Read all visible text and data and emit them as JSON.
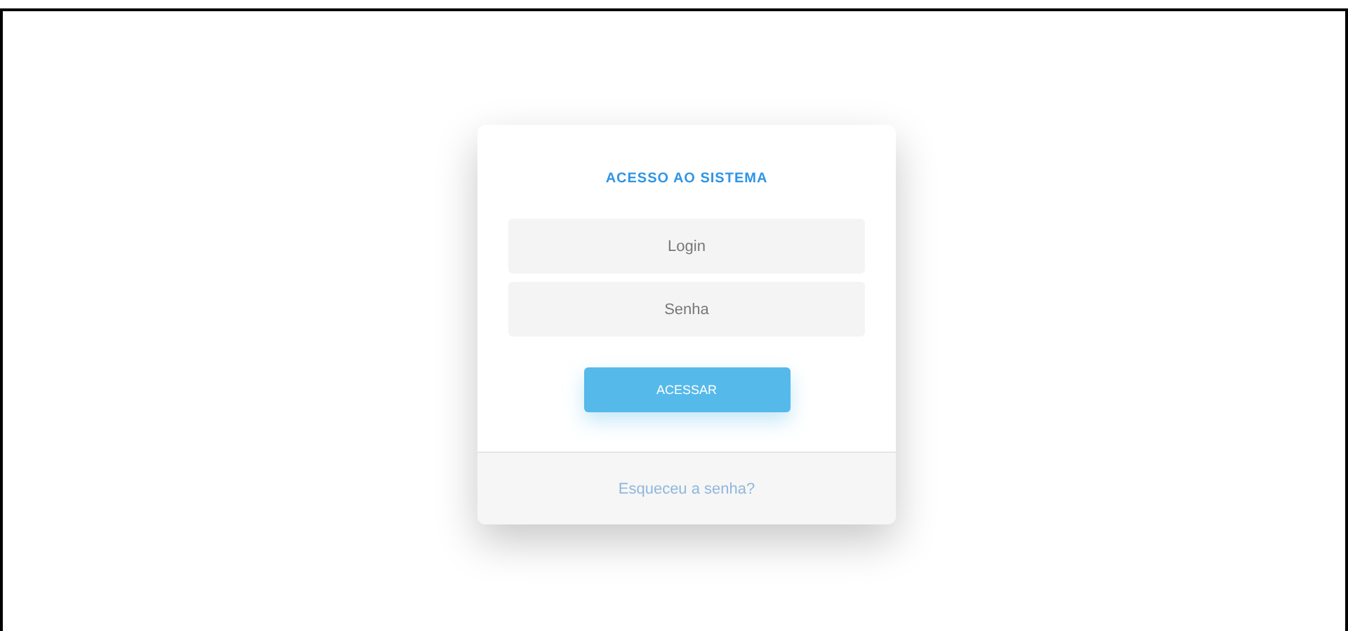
{
  "login_card": {
    "title": "ACESSO AO SISTEMA",
    "fields": [
      {
        "placeholder": "Login"
      },
      {
        "placeholder": "Senha"
      }
    ],
    "submit_button": "ACESSAR",
    "forgot_link": "Esqueceu a senha?"
  }
}
